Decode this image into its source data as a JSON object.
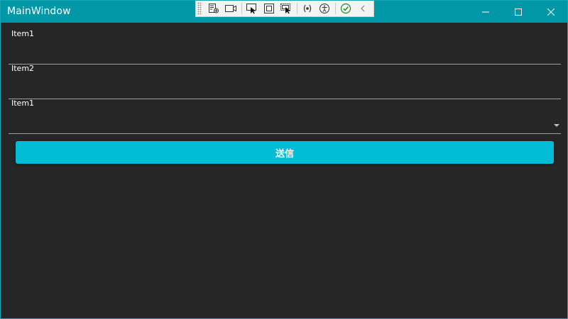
{
  "window": {
    "title": "MainWindow"
  },
  "form": {
    "field1_label": "Item1",
    "field1_value": "",
    "field2_label": "Item2",
    "field2_value": "",
    "combo_label": "Item1",
    "combo_value": "",
    "submit_label": "送信"
  },
  "colors": {
    "titlebar": "#0097a7",
    "background": "#262626",
    "accent": "#00bcd4",
    "underline": "#9e9e9e"
  },
  "debug_toolbar": {
    "icons": [
      "live-visual-tree-icon",
      "video-camera-icon",
      "select-element-icon",
      "display-layout-adorners-icon",
      "track-focus-icon",
      "binding-failures-icon",
      "accessibility-icon",
      "checkmark-icon",
      "collapse-chevron-icon"
    ]
  }
}
